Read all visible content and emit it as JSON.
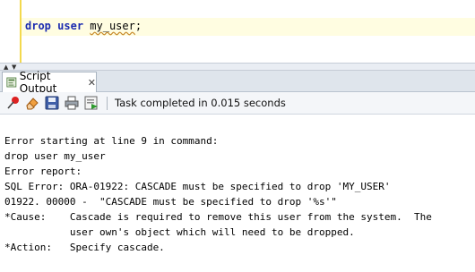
{
  "editor": {
    "code": {
      "keyword_drop": "drop",
      "keyword_user": "user",
      "identifier": "my_user",
      "terminator": ";"
    }
  },
  "panel": {
    "tab_label": "Script Output",
    "tab_icon": "script-output-icon",
    "close_glyph": "✕"
  },
  "toolbar": {
    "icons": [
      "pin-icon",
      "eraser-icon",
      "save-icon",
      "print-icon",
      "run-icon"
    ],
    "status": "Task completed in 0.015 seconds"
  },
  "output": {
    "lines": [
      "Error starting at line 9 in command:",
      "drop user my_user",
      "Error report:",
      "SQL Error: ORA-01922: CASCADE must be specified to drop 'MY_USER'",
      "01922. 00000 -  \"CASCADE must be specified to drop '%s'\"",
      "*Cause:    Cascade is required to remove this user from the system.  The",
      "           user own's object which will need to be dropped.",
      "*Action:   Specify cascade."
    ]
  },
  "colors": {
    "keyword": "#1b2bb0",
    "current_line": "#fffde1",
    "margin_marker": "#f3d94e"
  }
}
